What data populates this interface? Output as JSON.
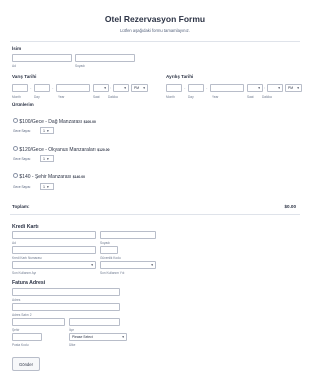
{
  "form": {
    "title": "Otel Rezervasyon Formu",
    "subtitle": "Lütfen aşağıdaki formu tamamlayınız."
  },
  "name": {
    "label": "İsim",
    "first_sub": "Ad",
    "last_sub": "Soyadı"
  },
  "arrival": {
    "label": "Varış Tarihi",
    "sep": "-",
    "sep2": "-",
    "month_sub": "Month",
    "day_sub": "Day",
    "year_sub": "Year",
    "hour_sub": "Saat",
    "minute_sub": "Dakika",
    "hour_sep": ":",
    "hour_value": "",
    "minute_value": "",
    "ampm_value": "PM"
  },
  "departure": {
    "label": "Ayrılış Tarihi",
    "sep": "-",
    "sep2": "-",
    "month_sub": "Month",
    "day_sub": "Day",
    "year_sub": "Year",
    "hour_sub": "Saat",
    "minute_sub": "Dakika",
    "hour_sep": ":",
    "hour_value": "",
    "minute_value": "",
    "ampm_value": "PM"
  },
  "products": {
    "label": "Ürünlerim",
    "qty_label": "Gece Sayısı",
    "items": [
      {
        "label": "$100/Gece - Dağ Manzarası",
        "price": "$100.00",
        "qty": "1"
      },
      {
        "label": "$120/Gece - Okyanus Manzaraları",
        "price": "$120.00",
        "qty": "1"
      },
      {
        "label": "$140 - Şehir Manzarası",
        "price": "$140.00",
        "qty": "1"
      }
    ]
  },
  "total": {
    "label": "Toplam:",
    "value": "$0.00"
  },
  "credit_card": {
    "title": "Kredi Kartı",
    "first_sub": "Ad",
    "last_sub": "Soyadı",
    "number_sub": "Kredi Kartı Numarası",
    "cvv_sub": "Güvenlik Kodu",
    "exp_month_sub": "Son Kullanım Ayı",
    "exp_year_sub": "Son Kullanım Yılı"
  },
  "billing": {
    "title": "Fatura Adresi",
    "address_sub": "Adres",
    "address2_sub": "Adres Satırı 2",
    "city_sub": "Şehir",
    "state_sub": "İlçe",
    "state_value": "Please Select",
    "zip_sub": "Posta Kodu",
    "country_sub": "Ülke"
  },
  "submit": {
    "label": "Gönder"
  }
}
